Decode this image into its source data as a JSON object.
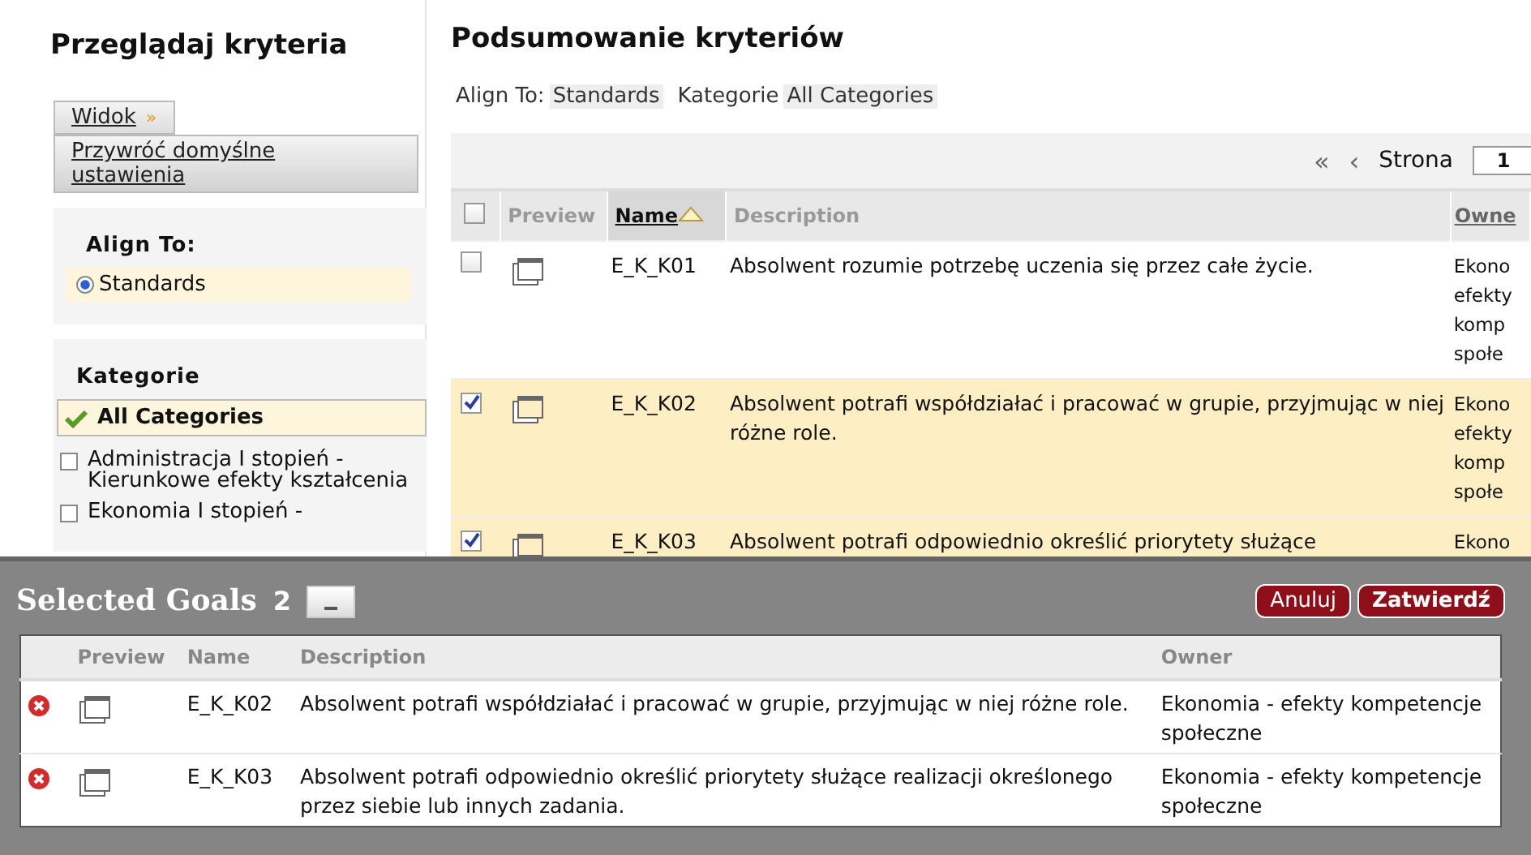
{
  "sidebar": {
    "title": "Przeglądaj kryteria",
    "view_button": "Widok",
    "view_chevron": "»",
    "reset_link": "Przywróć domyślne ustawienia",
    "align_to": {
      "heading": "Align To:",
      "options": [
        {
          "label": "Standards",
          "selected": true
        }
      ]
    },
    "categories": {
      "heading": "Kategorie",
      "items": [
        {
          "label": "All Categories",
          "selected": true
        },
        {
          "label": "Administracja I stopień - Kierunkowe efekty kształcenia",
          "selected": false
        },
        {
          "label": "Ekonomia I stopień -",
          "selected": false
        }
      ]
    }
  },
  "main": {
    "title": "Podsumowanie kryteriów",
    "filters": [
      {
        "label": "Align To:",
        "value": "Standards"
      },
      {
        "label": "Kategorie",
        "value": "All Categories"
      }
    ],
    "pager": {
      "first": "«",
      "previous": "‹",
      "label": "Strona",
      "page": "1"
    },
    "table": {
      "all_checked": false,
      "columns": [
        {
          "label": "Preview",
          "sorted": false
        },
        {
          "label": "Name",
          "sorted": true
        },
        {
          "label": "Description",
          "sorted": false
        },
        {
          "label": "Owne",
          "sorted": false
        }
      ],
      "rows": [
        {
          "checked": false,
          "name": "E_K_K01",
          "description": "Absolwent rozumie potrzebę uczenia się przez całe życie.",
          "owner": "Ekono efekty komp społe"
        },
        {
          "checked": true,
          "name": "E_K_K02",
          "description": "Absolwent potrafi współdziałać i pracować w grupie, przyjmując w niej różne role.",
          "owner": "Ekono efekty komp społe"
        },
        {
          "checked": true,
          "name": "E_K_K03",
          "description": "Absolwent potrafi odpowiednio określić priorytety służące",
          "owner": "Ekono"
        }
      ]
    }
  },
  "selected_panel": {
    "title": "Selected Goals",
    "count": "2",
    "buttons": [
      "Anuluj",
      "Zatwierdź"
    ],
    "columns": [
      "Preview",
      "Name",
      "Description",
      "Owner"
    ],
    "rows": [
      {
        "name": "E_K_K02",
        "description": "Absolwent potrafi współdziałać i pracować w grupie, przyjmując w niej różne role.",
        "owner": "Ekonomia - efekty kompetencje społeczne"
      },
      {
        "name": "E_K_K03",
        "description": "Absolwent potrafi odpowiednio określić priorytety służące realizacji określonego przez siebie lub innych zadania.",
        "owner": "Ekonomia - efekty kompetencje społeczne"
      }
    ]
  }
}
